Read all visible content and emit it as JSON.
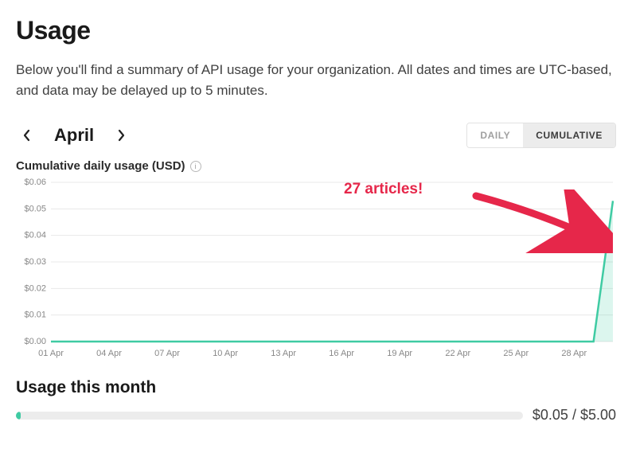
{
  "header": {
    "title": "Usage",
    "description": "Below you'll find a summary of API usage for your organization. All dates and times are UTC-based, and data may be delayed up to 5 minutes."
  },
  "nav": {
    "month": "April",
    "toggle_daily": "DAILY",
    "toggle_cumulative": "CUMULATIVE"
  },
  "chart_title": "Cumulative daily usage (USD)",
  "annotation": "27 articles!",
  "usage_section": {
    "title": "Usage this month",
    "current": "$0.05",
    "limit": "$5.00",
    "separator": " / ",
    "percent": 1
  },
  "chart_data": {
    "type": "area",
    "title": "Cumulative daily usage (USD)",
    "xlabel": "",
    "ylabel": "",
    "ylim": [
      0,
      0.06
    ],
    "y_ticks": [
      "$0.00",
      "$0.01",
      "$0.02",
      "$0.03",
      "$0.04",
      "$0.05",
      "$0.06"
    ],
    "x_ticks": [
      "01 Apr",
      "04 Apr",
      "07 Apr",
      "10 Apr",
      "13 Apr",
      "16 Apr",
      "19 Apr",
      "22 Apr",
      "25 Apr",
      "28 Apr"
    ],
    "x": [
      "01 Apr",
      "02 Apr",
      "03 Apr",
      "04 Apr",
      "05 Apr",
      "06 Apr",
      "07 Apr",
      "08 Apr",
      "09 Apr",
      "10 Apr",
      "11 Apr",
      "12 Apr",
      "13 Apr",
      "14 Apr",
      "15 Apr",
      "16 Apr",
      "17 Apr",
      "18 Apr",
      "19 Apr",
      "20 Apr",
      "21 Apr",
      "22 Apr",
      "23 Apr",
      "24 Apr",
      "25 Apr",
      "26 Apr",
      "27 Apr",
      "28 Apr",
      "29 Apr",
      "30 Apr"
    ],
    "values": [
      0,
      0,
      0,
      0,
      0,
      0,
      0,
      0,
      0,
      0,
      0,
      0,
      0,
      0,
      0,
      0,
      0,
      0,
      0,
      0,
      0,
      0,
      0,
      0,
      0,
      0,
      0,
      0,
      0,
      0.053
    ]
  },
  "colors": {
    "accent": "#3fcba3",
    "annotation": "#e6274a"
  }
}
